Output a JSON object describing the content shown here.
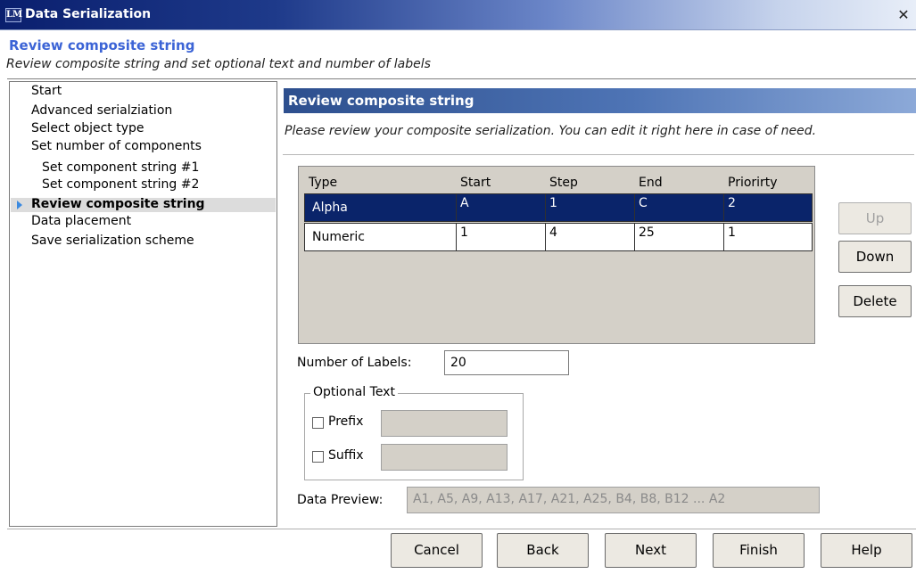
{
  "window": {
    "app_icon_text": "LM",
    "title": "Data Serialization",
    "close_glyph": "✕"
  },
  "header": {
    "title": "Review composite string",
    "subtitle": "Review composite string and set optional text and number of labels"
  },
  "nav": {
    "items": [
      {
        "label": "Start",
        "sub": false,
        "active": false
      },
      {
        "label": "Advanced serialziation",
        "sub": false,
        "active": false
      },
      {
        "label": "Select object type",
        "sub": false,
        "active": false
      },
      {
        "label": "Set number of components",
        "sub": false,
        "active": false
      },
      {
        "label": "Set component string #1",
        "sub": true,
        "active": false
      },
      {
        "label": "Set component string #2",
        "sub": true,
        "active": false
      },
      {
        "label": "Review composite string",
        "sub": false,
        "active": true
      },
      {
        "label": "Data placement",
        "sub": false,
        "active": false
      },
      {
        "label": "Save serialization scheme",
        "sub": false,
        "active": false
      }
    ]
  },
  "content": {
    "section_title": "Review composite string",
    "description": "Please review your composite serialization. You can edit it right here in case of need.",
    "grid": {
      "columns": [
        "Type",
        "Start",
        "Step",
        "End",
        "Priorirty"
      ],
      "rows": [
        {
          "cells": [
            "Alpha",
            "A",
            "1",
            "C",
            "2"
          ],
          "selected": true
        },
        {
          "cells": [
            "Numeric",
            "1",
            "4",
            "25",
            "1"
          ],
          "selected": false
        }
      ]
    },
    "buttons": {
      "up": "Up",
      "down": "Down",
      "delete": "Delete"
    },
    "number_of_labels_label": "Number of Labels:",
    "number_of_labels_value": "20",
    "optional_text": {
      "legend": "Optional Text",
      "prefix_label": "Prefix",
      "prefix_checked": false,
      "prefix_value": "",
      "suffix_label": "Suffix",
      "suffix_checked": false,
      "suffix_value": ""
    },
    "data_preview_label": "Data Preview:",
    "data_preview_value": "A1, A5, A9, A13, A17, A21, A25, B4, B8, B12 ... A2"
  },
  "footer": {
    "cancel": "Cancel",
    "back": "Back",
    "next": "Next",
    "finish": "Finish",
    "help": "Help"
  },
  "colors": {
    "selection": "#0a246a",
    "header_title": "#3c64d6",
    "section_header": "#4e74b5"
  }
}
